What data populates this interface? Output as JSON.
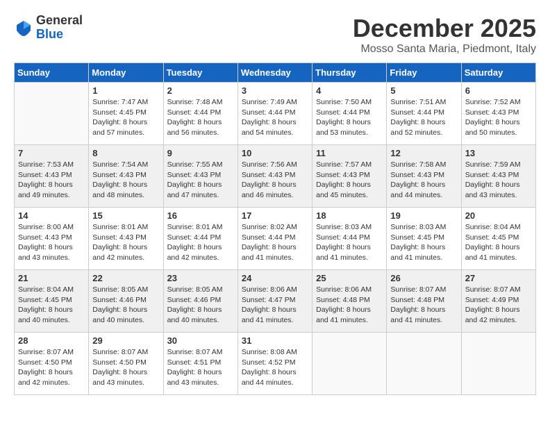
{
  "logo": {
    "general": "General",
    "blue": "Blue"
  },
  "title": "December 2025",
  "location": "Mosso Santa Maria, Piedmont, Italy",
  "weekdays": [
    "Sunday",
    "Monday",
    "Tuesday",
    "Wednesday",
    "Thursday",
    "Friday",
    "Saturday"
  ],
  "weeks": [
    [
      {
        "day": "",
        "sunrise": "",
        "sunset": "",
        "daylight": ""
      },
      {
        "day": "1",
        "sunrise": "Sunrise: 7:47 AM",
        "sunset": "Sunset: 4:45 PM",
        "daylight": "Daylight: 8 hours and 57 minutes."
      },
      {
        "day": "2",
        "sunrise": "Sunrise: 7:48 AM",
        "sunset": "Sunset: 4:44 PM",
        "daylight": "Daylight: 8 hours and 56 minutes."
      },
      {
        "day": "3",
        "sunrise": "Sunrise: 7:49 AM",
        "sunset": "Sunset: 4:44 PM",
        "daylight": "Daylight: 8 hours and 54 minutes."
      },
      {
        "day": "4",
        "sunrise": "Sunrise: 7:50 AM",
        "sunset": "Sunset: 4:44 PM",
        "daylight": "Daylight: 8 hours and 53 minutes."
      },
      {
        "day": "5",
        "sunrise": "Sunrise: 7:51 AM",
        "sunset": "Sunset: 4:44 PM",
        "daylight": "Daylight: 8 hours and 52 minutes."
      },
      {
        "day": "6",
        "sunrise": "Sunrise: 7:52 AM",
        "sunset": "Sunset: 4:43 PM",
        "daylight": "Daylight: 8 hours and 50 minutes."
      }
    ],
    [
      {
        "day": "7",
        "sunrise": "Sunrise: 7:53 AM",
        "sunset": "Sunset: 4:43 PM",
        "daylight": "Daylight: 8 hours and 49 minutes."
      },
      {
        "day": "8",
        "sunrise": "Sunrise: 7:54 AM",
        "sunset": "Sunset: 4:43 PM",
        "daylight": "Daylight: 8 hours and 48 minutes."
      },
      {
        "day": "9",
        "sunrise": "Sunrise: 7:55 AM",
        "sunset": "Sunset: 4:43 PM",
        "daylight": "Daylight: 8 hours and 47 minutes."
      },
      {
        "day": "10",
        "sunrise": "Sunrise: 7:56 AM",
        "sunset": "Sunset: 4:43 PM",
        "daylight": "Daylight: 8 hours and 46 minutes."
      },
      {
        "day": "11",
        "sunrise": "Sunrise: 7:57 AM",
        "sunset": "Sunset: 4:43 PM",
        "daylight": "Daylight: 8 hours and 45 minutes."
      },
      {
        "day": "12",
        "sunrise": "Sunrise: 7:58 AM",
        "sunset": "Sunset: 4:43 PM",
        "daylight": "Daylight: 8 hours and 44 minutes."
      },
      {
        "day": "13",
        "sunrise": "Sunrise: 7:59 AM",
        "sunset": "Sunset: 4:43 PM",
        "daylight": "Daylight: 8 hours and 43 minutes."
      }
    ],
    [
      {
        "day": "14",
        "sunrise": "Sunrise: 8:00 AM",
        "sunset": "Sunset: 4:43 PM",
        "daylight": "Daylight: 8 hours and 43 minutes."
      },
      {
        "day": "15",
        "sunrise": "Sunrise: 8:01 AM",
        "sunset": "Sunset: 4:43 PM",
        "daylight": "Daylight: 8 hours and 42 minutes."
      },
      {
        "day": "16",
        "sunrise": "Sunrise: 8:01 AM",
        "sunset": "Sunset: 4:44 PM",
        "daylight": "Daylight: 8 hours and 42 minutes."
      },
      {
        "day": "17",
        "sunrise": "Sunrise: 8:02 AM",
        "sunset": "Sunset: 4:44 PM",
        "daylight": "Daylight: 8 hours and 41 minutes."
      },
      {
        "day": "18",
        "sunrise": "Sunrise: 8:03 AM",
        "sunset": "Sunset: 4:44 PM",
        "daylight": "Daylight: 8 hours and 41 minutes."
      },
      {
        "day": "19",
        "sunrise": "Sunrise: 8:03 AM",
        "sunset": "Sunset: 4:45 PM",
        "daylight": "Daylight: 8 hours and 41 minutes."
      },
      {
        "day": "20",
        "sunrise": "Sunrise: 8:04 AM",
        "sunset": "Sunset: 4:45 PM",
        "daylight": "Daylight: 8 hours and 41 minutes."
      }
    ],
    [
      {
        "day": "21",
        "sunrise": "Sunrise: 8:04 AM",
        "sunset": "Sunset: 4:45 PM",
        "daylight": "Daylight: 8 hours and 40 minutes."
      },
      {
        "day": "22",
        "sunrise": "Sunrise: 8:05 AM",
        "sunset": "Sunset: 4:46 PM",
        "daylight": "Daylight: 8 hours and 40 minutes."
      },
      {
        "day": "23",
        "sunrise": "Sunrise: 8:05 AM",
        "sunset": "Sunset: 4:46 PM",
        "daylight": "Daylight: 8 hours and 40 minutes."
      },
      {
        "day": "24",
        "sunrise": "Sunrise: 8:06 AM",
        "sunset": "Sunset: 4:47 PM",
        "daylight": "Daylight: 8 hours and 41 minutes."
      },
      {
        "day": "25",
        "sunrise": "Sunrise: 8:06 AM",
        "sunset": "Sunset: 4:48 PM",
        "daylight": "Daylight: 8 hours and 41 minutes."
      },
      {
        "day": "26",
        "sunrise": "Sunrise: 8:07 AM",
        "sunset": "Sunset: 4:48 PM",
        "daylight": "Daylight: 8 hours and 41 minutes."
      },
      {
        "day": "27",
        "sunrise": "Sunrise: 8:07 AM",
        "sunset": "Sunset: 4:49 PM",
        "daylight": "Daylight: 8 hours and 42 minutes."
      }
    ],
    [
      {
        "day": "28",
        "sunrise": "Sunrise: 8:07 AM",
        "sunset": "Sunset: 4:50 PM",
        "daylight": "Daylight: 8 hours and 42 minutes."
      },
      {
        "day": "29",
        "sunrise": "Sunrise: 8:07 AM",
        "sunset": "Sunset: 4:50 PM",
        "daylight": "Daylight: 8 hours and 43 minutes."
      },
      {
        "day": "30",
        "sunrise": "Sunrise: 8:07 AM",
        "sunset": "Sunset: 4:51 PM",
        "daylight": "Daylight: 8 hours and 43 minutes."
      },
      {
        "day": "31",
        "sunrise": "Sunrise: 8:08 AM",
        "sunset": "Sunset: 4:52 PM",
        "daylight": "Daylight: 8 hours and 44 minutes."
      },
      {
        "day": "",
        "sunrise": "",
        "sunset": "",
        "daylight": ""
      },
      {
        "day": "",
        "sunrise": "",
        "sunset": "",
        "daylight": ""
      },
      {
        "day": "",
        "sunrise": "",
        "sunset": "",
        "daylight": ""
      }
    ]
  ]
}
